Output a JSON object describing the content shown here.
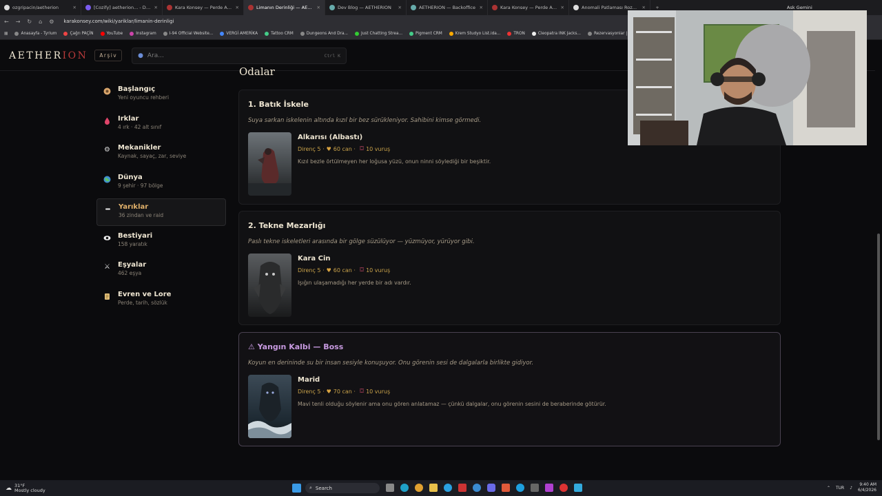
{
  "browser": {
    "tabs": [
      {
        "label": "ozgripacin/aetherion",
        "active": false
      },
      {
        "label": "[Cozify] aetherion... - Deploy",
        "active": false
      },
      {
        "label": "Kara Konsey — Perde Aralanıyor",
        "active": false
      },
      {
        "label": "Limanın Derinliği — AETHERION",
        "active": true
      },
      {
        "label": "Dev Blog — AETHERION",
        "active": false
      },
      {
        "label": "AETHERION — Backoffice",
        "active": false
      },
      {
        "label": "Kara Konsey — Perde Aralanıyor",
        "active": false
      },
      {
        "label": "Anomali Patlaması Rozetleri Sl...",
        "active": false
      }
    ],
    "profile_label": "Ask Gemini",
    "url": "karakonsey.com/wiki/yariklar/limanin-derinligi",
    "bookmarks": [
      "Anasayfa - Tyrium",
      "Çağrı PAÇİN",
      "YouTube",
      "Instagram",
      "I-94 Official Website...",
      "VERGİ AMERİKA",
      "Tattoo CRM",
      "Dungeons And Dra...",
      "Just Chatting Strea...",
      "Pigment CRM",
      "Krem Studyo List.ida...",
      "TRON",
      "Cleopatra INK Jacks...",
      "Rezervasyonlar | Clo..."
    ]
  },
  "header": {
    "logo_main": "AETHER",
    "logo_accent": "ION",
    "archive_label": "Arşiv",
    "search_placeholder": "Ara...",
    "search_shortcut": "Ctrl K"
  },
  "sidebar": {
    "items": [
      {
        "label": "Başlangıç",
        "sub": "Yeni oyuncu rehberi",
        "icon": "compass-icon",
        "active": false
      },
      {
        "label": "Irklar",
        "sub": "4 ırk · 42 alt sınıf",
        "icon": "drop-icon",
        "active": false
      },
      {
        "label": "Mekanikler",
        "sub": "Kaynak, sayaç, zar, seviye",
        "icon": "gear-icon",
        "active": false
      },
      {
        "label": "Dünya",
        "sub": "9 şehir · 97 bölge",
        "icon": "globe-icon",
        "active": false
      },
      {
        "label": "Yarıklar",
        "sub": "36 zindan ve raid",
        "icon": "dash-icon",
        "active": true
      },
      {
        "label": "Bestiyari",
        "sub": "158 yaratık",
        "icon": "eye-icon",
        "active": false
      },
      {
        "label": "Eşyalar",
        "sub": "462 eşya",
        "icon": "swords-icon",
        "active": false
      },
      {
        "label": "Evren ve Lore",
        "sub": "Perde, tarih, sözlük",
        "icon": "scroll-icon",
        "active": false
      }
    ]
  },
  "main": {
    "title": "Odalar",
    "rooms": [
      {
        "title": "1. Batık İskele",
        "desc": "Suya sarkan iskelenin altında kızıl bir bez sürükleniyor. Sahibini kimse görmedi.",
        "boss": false,
        "monster": {
          "name": "Alkarısı (Albastı)",
          "stats": "Direnç 5 ·",
          "hp": "60 can ·",
          "hits": "10 vuruş",
          "desc": "Kızıl bezle örtülmeyen her loğusa yüzü, onun ninni söylediği bir beşiktir."
        }
      },
      {
        "title": "2. Tekne Mezarlığı",
        "desc": "Paslı tekne iskeletleri arasında bir gölge süzülüyor — yüzmüyor, yürüyor gibi.",
        "boss": false,
        "monster": {
          "name": "Kara Cin",
          "stats": "Direnç 5 ·",
          "hp": "60 can ·",
          "hits": "10 vuruş",
          "desc": "Işığın ulaşamadığı her yerde bir adı vardır."
        }
      },
      {
        "title": "⚠ Yangın Kalbi — Boss",
        "desc": "Koyun en derininde su bir insan sesiyle konuşuyor. Onu görenin sesi de dalgalarla birlikte gidiyor.",
        "boss": true,
        "monster": {
          "name": "Marid",
          "stats": "Direnç 5 ·",
          "hp": "70 can ·",
          "hits": "10 vuruş",
          "desc": "Mavi tenli olduğu söylenir ama onu gören anlatamaz — çünkü dalgalar, onu görenin sesini de beraberinde götürür."
        }
      }
    ]
  },
  "taskbar": {
    "weather_temp": "31°F",
    "weather_text": "Mostly cloudy",
    "search_label": "Search",
    "lang": "TUR",
    "time": "9:40 AM",
    "date": "6/4/2026"
  },
  "colors": {
    "accent_gold": "#e0b06a",
    "accent_red": "#b83a3a",
    "boss_purple": "#c79ae0",
    "background": "#0b0b0d"
  }
}
